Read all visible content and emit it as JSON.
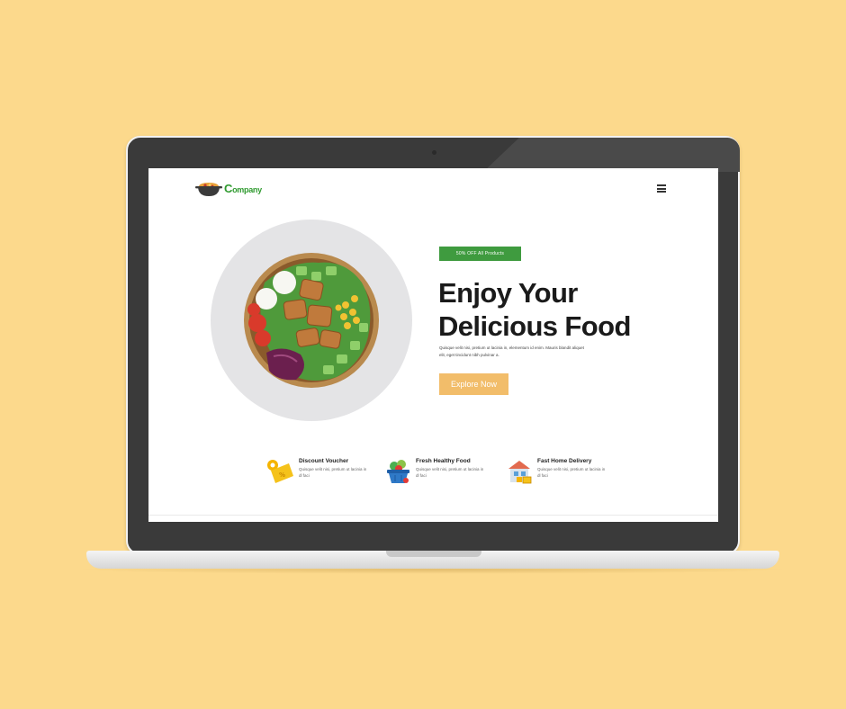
{
  "brand": {
    "logo_text_big": "C",
    "logo_text_small": "ompany"
  },
  "nav": {
    "menu_icon": "hamburger-icon"
  },
  "hero": {
    "badge": "50% OFF  All Products",
    "headline_line1": "Enjoy Your",
    "headline_line2": "Delicious Food",
    "description": "Quisque velit nisi, pretium ut lacinia in, elementum id enim. Mauris blandit aliquet elit, eget tincidunt nibh pulvinar a.",
    "cta_label": "Explore Now"
  },
  "features": [
    {
      "icon": "discount-voucher-icon",
      "title": "Discount Voucher",
      "description": "Quisque velit nisi, pretium ut lacinia in dl faci"
    },
    {
      "icon": "grocery-basket-icon",
      "title": "Fresh Healthy Food",
      "description": "Quisque velit nisi, pretium ut lacinia in dl faci"
    },
    {
      "icon": "home-delivery-icon",
      "title": "Fast Home Delivery",
      "description": "Quisque velit nisi, pretium ut lacinia in dl faci"
    }
  ],
  "colors": {
    "background": "#fcd98c",
    "brand_green": "#3f9b3f",
    "cta": "#f2bd6a",
    "bezel": "#3a3a3a"
  }
}
